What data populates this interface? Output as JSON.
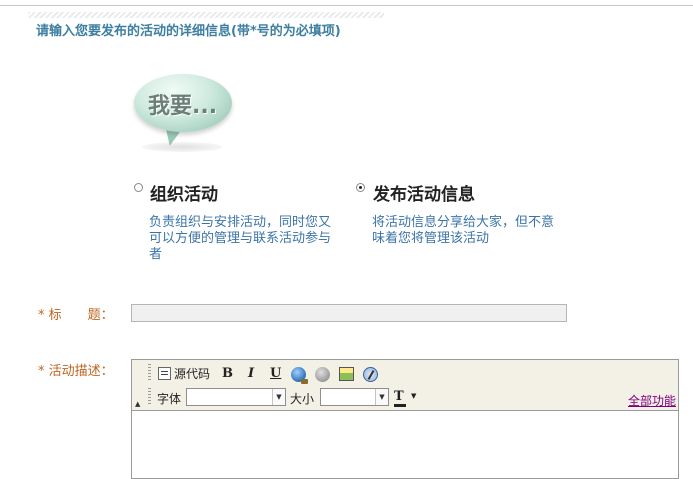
{
  "header": {
    "title": "请输入您要发布的活动的详细信息(带*号的为必填项)"
  },
  "bubble": {
    "text": "我要..."
  },
  "options": [
    {
      "label": "组织活动",
      "selected": false,
      "description_lines": [
        "负责组织与安排活动，同时您又",
        "可以方便的管理与联系活动参与",
        "者"
      ]
    },
    {
      "label": "发布活动信息",
      "selected": true,
      "description_lines": [
        "将活动信息分享给大家，但不意",
        "味着您将管理该活动"
      ]
    }
  ],
  "form": {
    "required_mark": "*",
    "title_label": "标　　题：",
    "title_value": "",
    "description_label": "活动描述："
  },
  "editor": {
    "toolbar": {
      "source_label": "源代码",
      "bold": "B",
      "italic": "I",
      "underline": "U",
      "font_label": "字体",
      "font_value": "",
      "size_label": "大小",
      "size_value": "",
      "color_letter": "T",
      "all_functions_label": "全部功能"
    },
    "content": ""
  },
  "colors": {
    "header_text": "#3d7fa0",
    "label_orange": "#c0641e",
    "description_blue": "#3b74a8",
    "link_purple": "#800080",
    "toolbar_bg": "#f3f1e6"
  }
}
